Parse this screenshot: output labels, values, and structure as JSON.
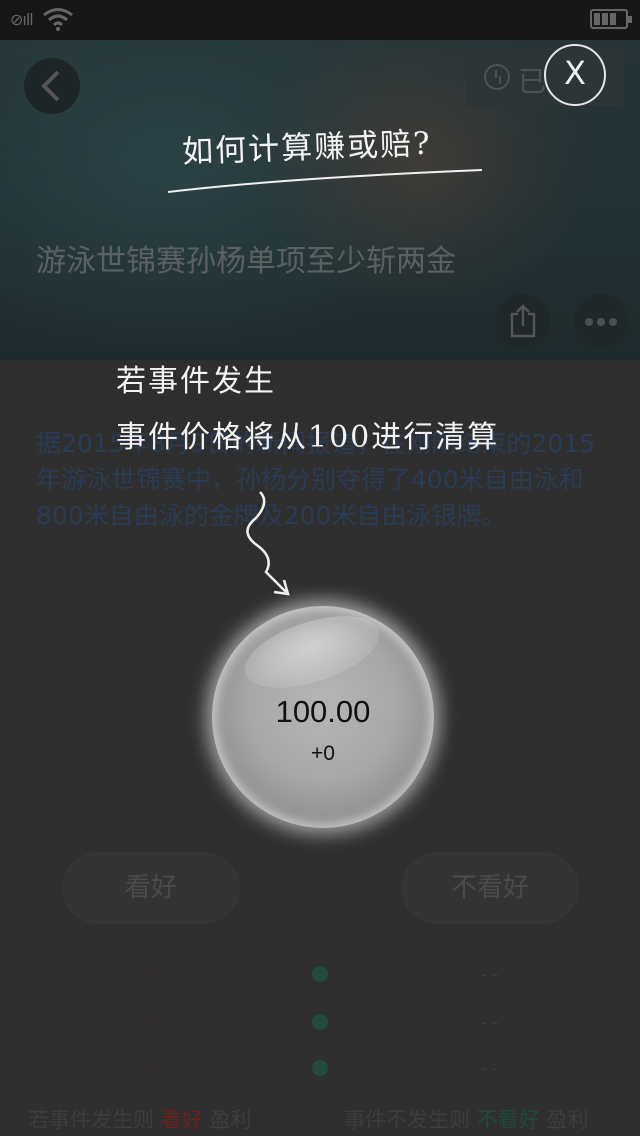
{
  "overlay": {
    "title": "如何计算赚或赔?",
    "note_line1": "若事件发生",
    "note_line2": "事件价格将从100进行清算",
    "close_label": "X"
  },
  "header": {
    "timer_label": "已",
    "title": "游泳世锦赛孙杨单项至少斩两金"
  },
  "article": {
    "text": "据2015年8月9日的新闻报道，在刚刚结束的2015年游泳世锦赛中，孙杨分别夺得了400米自由泳和800米自由泳的金牌及200米自由泳银牌。"
  },
  "bubble": {
    "price": "100.00",
    "change": "+0"
  },
  "actions": {
    "bull_label": "看好",
    "bear_label": "不看好"
  },
  "stats": {
    "left": [
      "--",
      "--",
      "--"
    ],
    "right": [
      "--",
      "--",
      "--"
    ]
  },
  "footer": {
    "left_prefix": "若事件发生则",
    "left_highlight": "看好",
    "left_suffix": "盈利",
    "right_prefix": "事件不发生则",
    "right_highlight": "不看好",
    "right_suffix": "盈利"
  },
  "colors": {
    "bull": "#7a1f1f",
    "bear": "#1f4a3a"
  }
}
